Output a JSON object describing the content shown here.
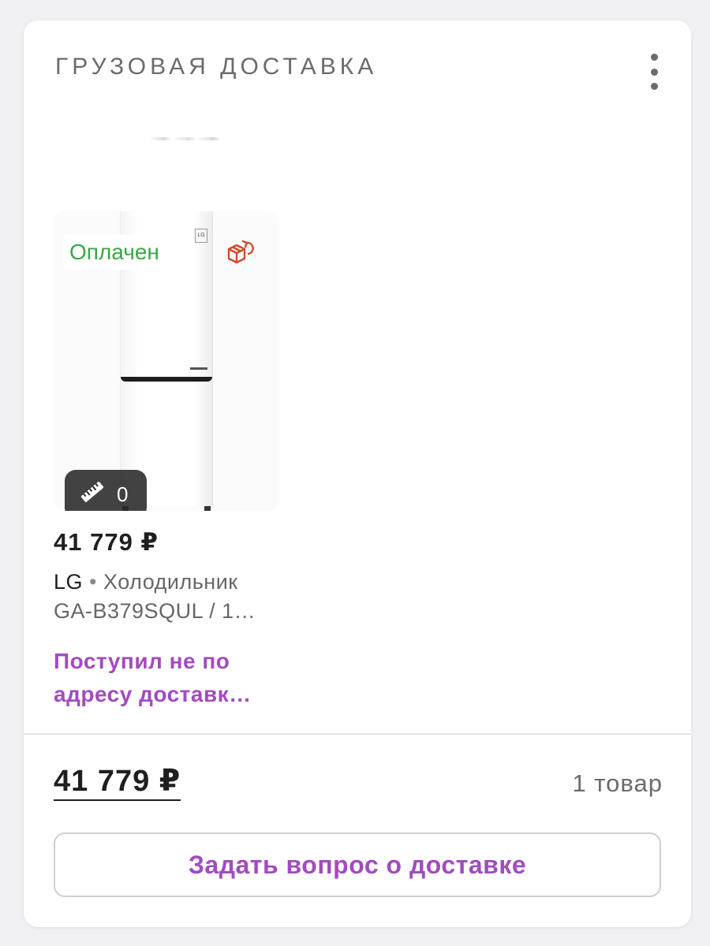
{
  "card": {
    "title": "ГРУЗОВАЯ ДОСТАВКА",
    "menu_icon": "more-vertical-icon"
  },
  "product": {
    "status": "Оплачен",
    "status_color": "#3aa845",
    "return_icon": "box-return-icon",
    "return_icon_color": "#d04a2a",
    "measure_icon": "ruler-icon",
    "measure_count": "0",
    "price": "41 779 ₽",
    "brand": "LG",
    "separator": "•",
    "name_line1": "Холодильник",
    "name_line2": "GA-B379SQUL / 1…",
    "delivery_status_line1": "Поступил не по",
    "delivery_status_line2": "адресу доставк…",
    "delivery_status_color": "#a24bbf"
  },
  "footer": {
    "total_price": "41 779 ₽",
    "items_count": "1 товар",
    "ask_button_label": "Задать вопрос о доставке"
  }
}
